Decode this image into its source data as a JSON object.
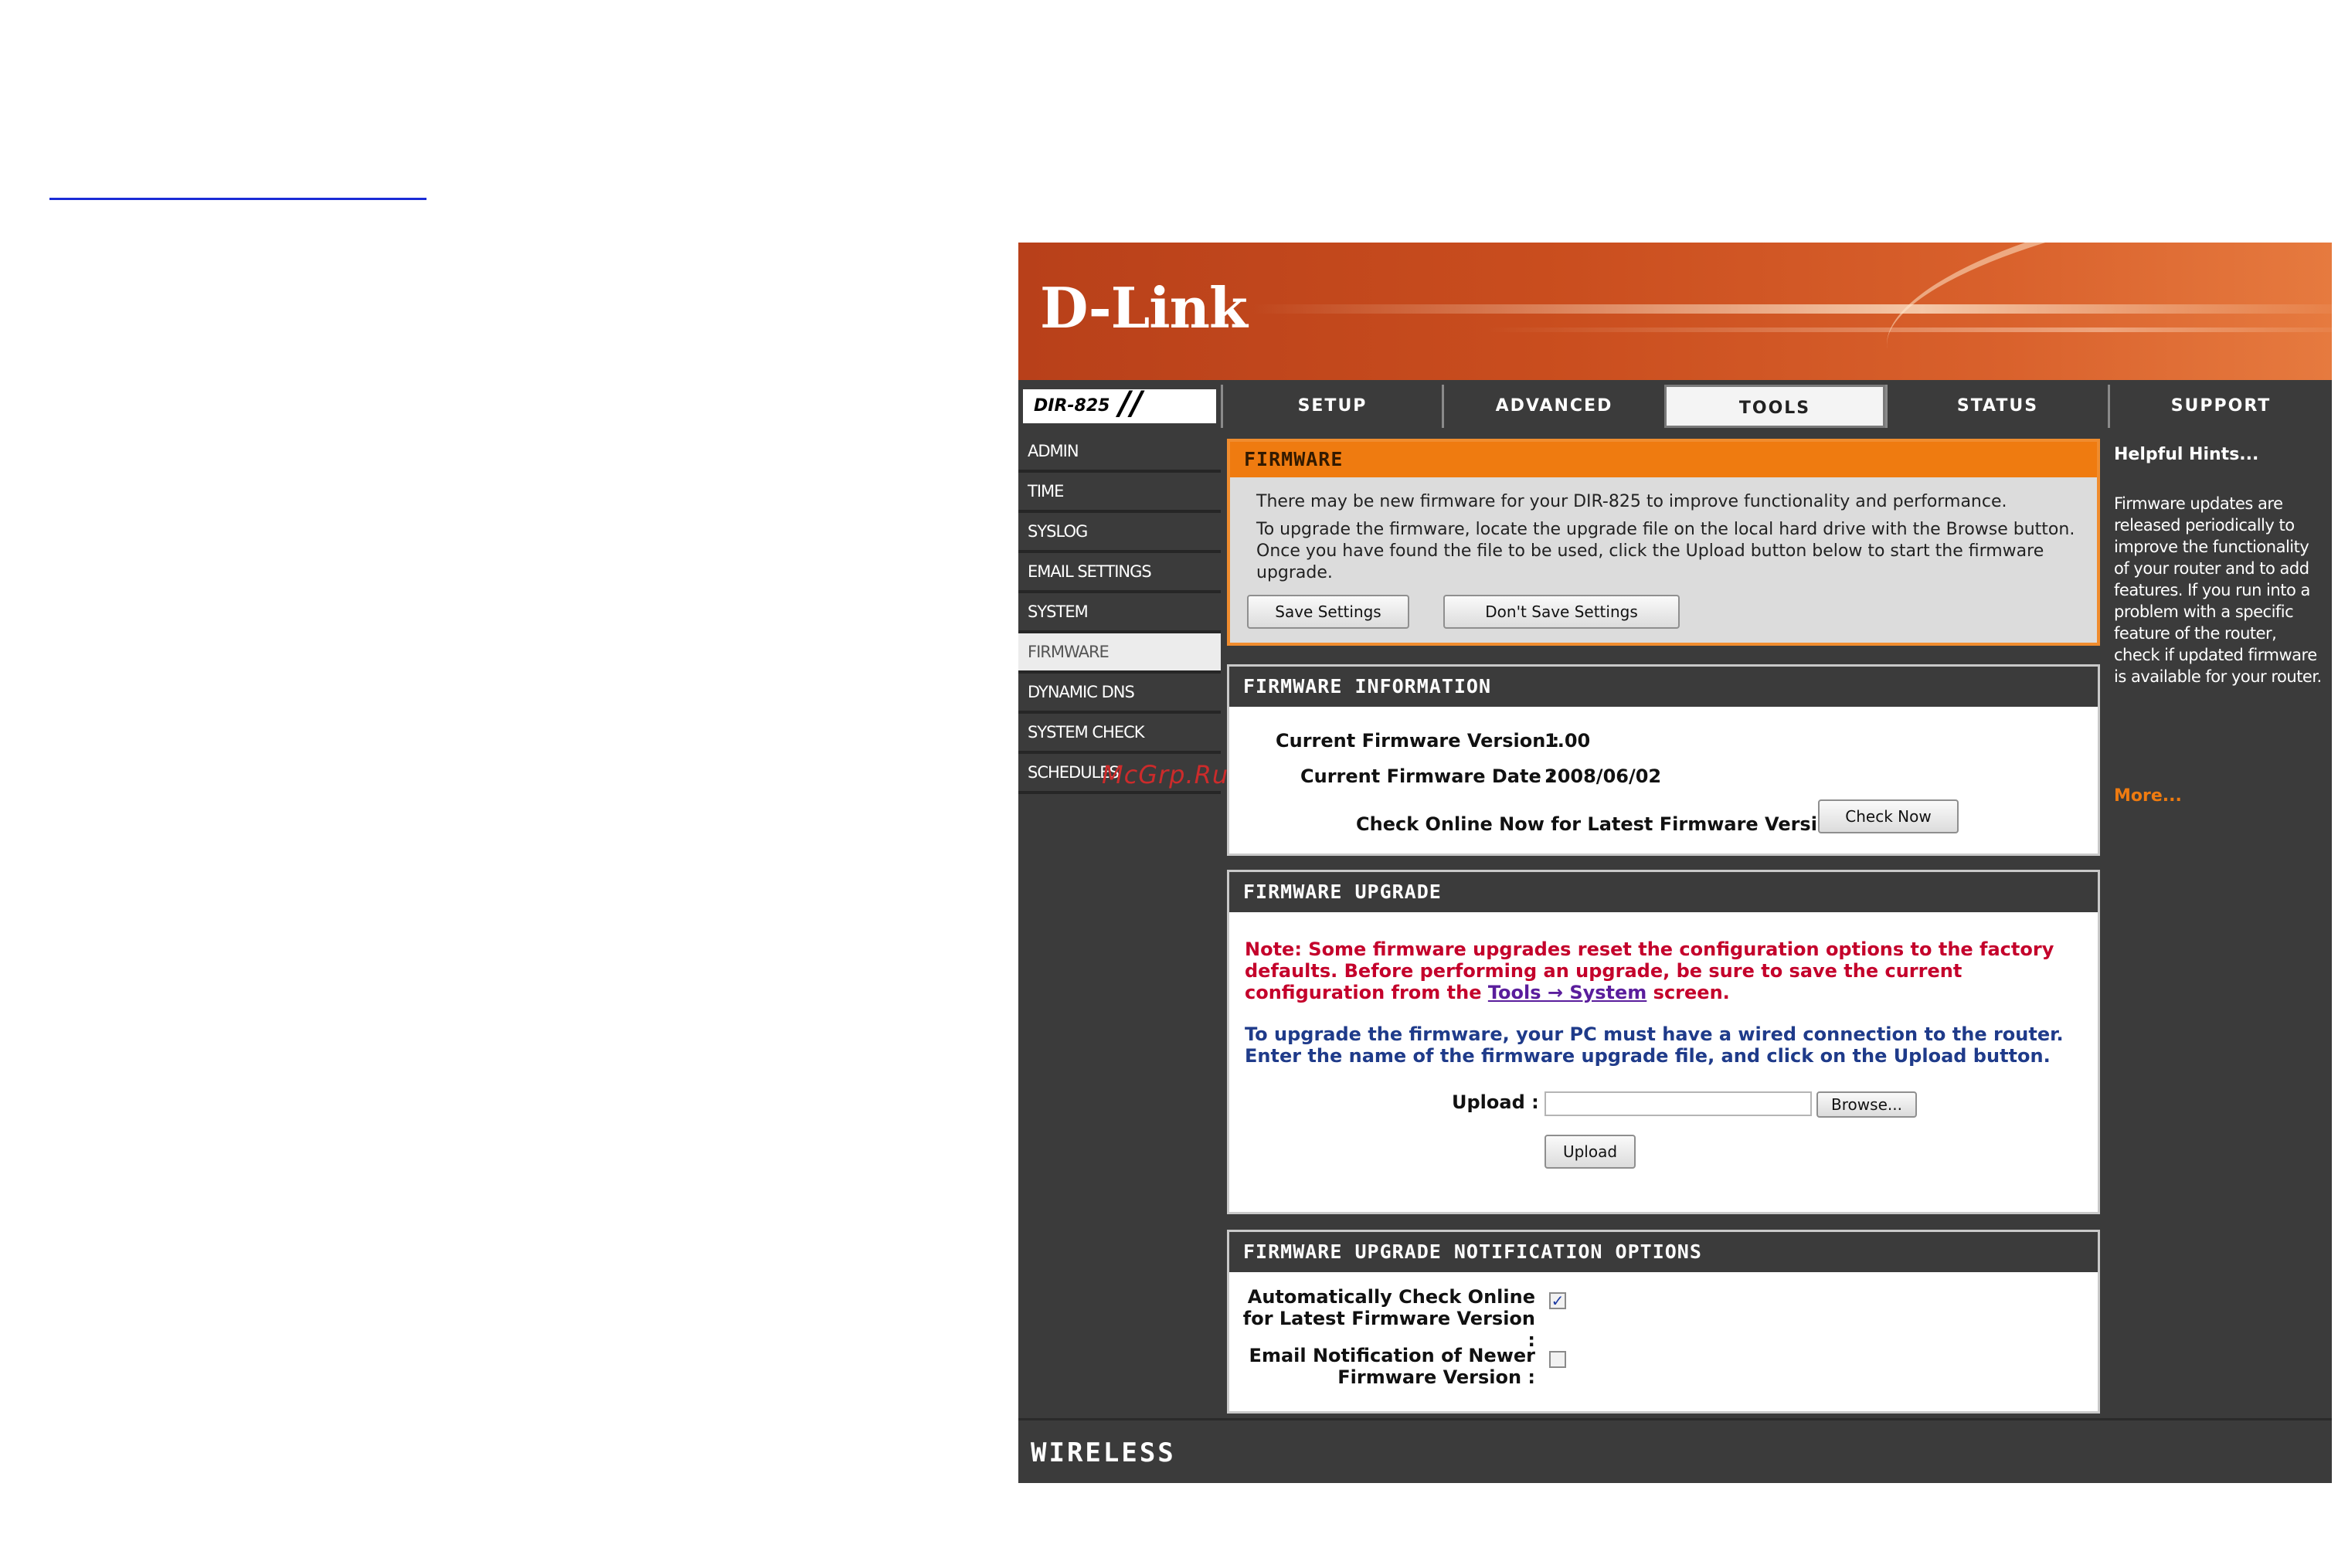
{
  "brand": {
    "logo": "D-Link",
    "model": "DIR-825",
    "footer": "WIRELESS"
  },
  "nav": {
    "tabs": [
      {
        "label": "SETUP"
      },
      {
        "label": "ADVANCED"
      },
      {
        "label": "TOOLS"
      },
      {
        "label": "STATUS"
      },
      {
        "label": "SUPPORT"
      }
    ],
    "active": "TOOLS"
  },
  "sidebar": {
    "items": [
      {
        "label": "ADMIN"
      },
      {
        "label": "TIME"
      },
      {
        "label": "SYSLOG"
      },
      {
        "label": "EMAIL SETTINGS"
      },
      {
        "label": "SYSTEM"
      },
      {
        "label": "FIRMWARE"
      },
      {
        "label": "DYNAMIC DNS"
      },
      {
        "label": "SYSTEM CHECK"
      },
      {
        "label": "SCHEDULES"
      }
    ],
    "active": "FIRMWARE"
  },
  "watermark": "McGrp.Ru",
  "firmware": {
    "title": "FIRMWARE",
    "intro1": "There may be new firmware for your DIR-825 to improve functionality and performance.",
    "intro2": "To upgrade the firmware, locate the upgrade file on the local hard drive with the Browse button. Once you have found the file to be used, click the Upload button below to start the firmware upgrade.",
    "save_label": "Save Settings",
    "dont_save_label": "Don't Save Settings"
  },
  "firmware_info": {
    "title": "FIRMWARE INFORMATION",
    "version_label": "Current Firmware Version :",
    "version_value": "1.00",
    "date_label": "Current Firmware Date :",
    "date_value": "2008/06/02",
    "check_label": "Check Online Now for Latest Firmware Version :",
    "check_button": "Check Now"
  },
  "firmware_upgrade": {
    "title": "FIRMWARE UPGRADE",
    "note_prefix": "Note: Some firmware upgrades reset the configuration options to the factory defaults. Before performing an upgrade, be sure to save the current configuration from the ",
    "note_link": "Tools → System",
    "note_suffix": " screen.",
    "instructions": "To upgrade the firmware, your PC must have a wired connection to the router. Enter the name of the firmware upgrade file, and click on the Upload button.",
    "upload_label": "Upload :",
    "upload_value": "",
    "browse_label": "Browse...",
    "upload_button": "Upload"
  },
  "notify": {
    "title": "FIRMWARE UPGRADE NOTIFICATION OPTIONS",
    "auto_label_1": "Automatically Check Online",
    "auto_label_2": "for Latest Firmware Version :",
    "auto_checked": "✓",
    "email_label_1": "Email Notification of Newer",
    "email_label_2": "Firmware Version :",
    "email_checked": ""
  },
  "hints": {
    "title": "Helpful Hints...",
    "body": "Firmware updates are released periodically to improve the functionality of your router and to add features. If you run into a problem with a specific feature of the router, check if updated firmware is available for your router.",
    "more": "More..."
  }
}
